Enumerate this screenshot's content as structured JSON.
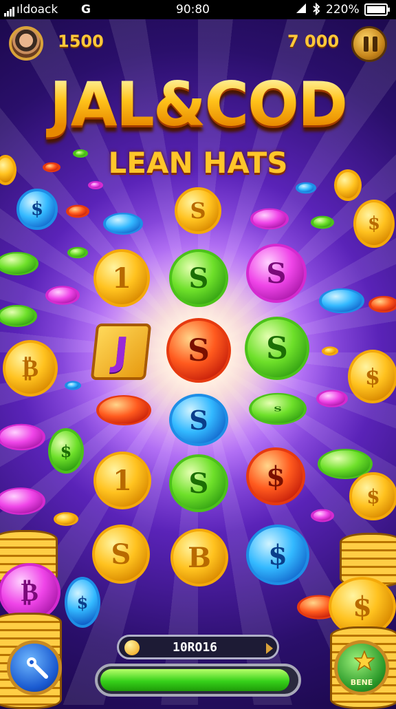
{
  "status_bar": {
    "carrier": "ıldoack",
    "g_icon": "G",
    "time": "90:80",
    "battery": "220%"
  },
  "hud": {
    "left_value": "1500",
    "right_value": "7 000",
    "pause_icon": "pause-icon",
    "avatar_icon": "player-avatar"
  },
  "title": {
    "main": "JAL&COD",
    "subtitle": "LEAN HATS"
  },
  "board": {
    "rows": [
      [
        "1",
        "S",
        "S"
      ],
      [
        "J",
        "S",
        "S"
      ],
      [
        "",
        "S",
        "S"
      ],
      [
        "1",
        "S",
        "$"
      ],
      [
        "S",
        "B",
        "$"
      ]
    ],
    "tile_letter": "J"
  },
  "score": {
    "value": "10RO16"
  },
  "progress": {
    "fraction": 0.97
  },
  "buttons": {
    "left_icon": "wrench-icon",
    "right_icon": "star-icon",
    "right_label": "BENE"
  },
  "colors": {
    "accent_gold": "#ffc21f",
    "progress_green": "#36d11a",
    "background_purple": "#5a23b8"
  }
}
